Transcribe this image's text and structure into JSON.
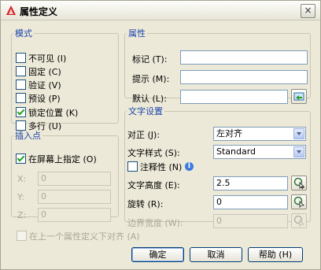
{
  "window": {
    "title": "属性定义",
    "close_glyph": "×"
  },
  "mode": {
    "legend": "模式",
    "items": [
      {
        "label": "不可见 (I)",
        "checked": false
      },
      {
        "label": "固定 (C)",
        "checked": false
      },
      {
        "label": "验证 (V)",
        "checked": false
      },
      {
        "label": "预设 (P)",
        "checked": false
      },
      {
        "label": "锁定位置 (K)",
        "checked": true
      },
      {
        "label": "多行 (U)",
        "checked": false
      }
    ]
  },
  "attribute": {
    "legend": "属性",
    "tag_label": "标记 (T):",
    "tag_value": "",
    "prompt_label": "提示 (M):",
    "prompt_value": "",
    "default_label": "默认 (L):",
    "default_value": ""
  },
  "insertion": {
    "legend": "插入点",
    "onscreen_label": "在屏幕上指定 (O)",
    "onscreen_checked": true,
    "x_label": "X:",
    "x_value": "0",
    "y_label": "Y:",
    "y_value": "0",
    "z_label": "Z:",
    "z_value": "0"
  },
  "text": {
    "legend": "文字设置",
    "justify_label": "对正 (J):",
    "justify_value": "左对齐",
    "style_label": "文字样式 (S):",
    "style_value": "Standard",
    "annotative_label": "注释性 (N)",
    "annotative_checked": false,
    "info_glyph": "i",
    "height_label": "文字高度 (E):",
    "height_value": "2.5",
    "rotation_label": "旋转 (R):",
    "rotation_value": "0",
    "boundary_label": "边界宽度 (W):",
    "boundary_value": "0"
  },
  "align_below": {
    "label": "在上一个属性定义下对齐 (A)",
    "checked": false
  },
  "buttons": {
    "ok": "确定",
    "cancel": "取消",
    "help": "帮助 (H)"
  }
}
